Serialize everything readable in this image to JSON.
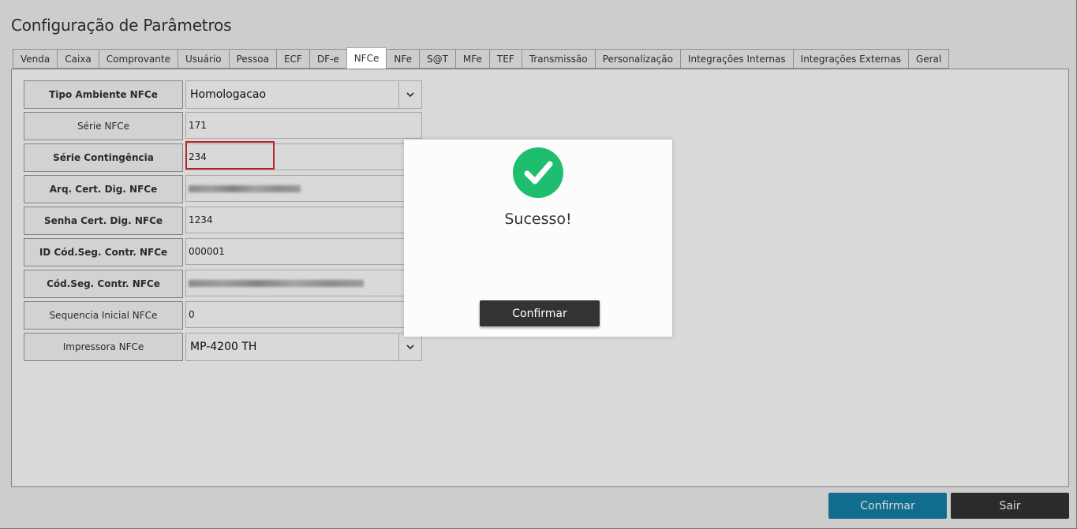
{
  "page": {
    "title": "Configuração de Parâmetros"
  },
  "tabs": [
    {
      "label": "Venda"
    },
    {
      "label": "Caixa"
    },
    {
      "label": "Comprovante"
    },
    {
      "label": "Usuário"
    },
    {
      "label": "Pessoa"
    },
    {
      "label": "ECF"
    },
    {
      "label": "DF-e"
    },
    {
      "label": "NFCe",
      "active": true
    },
    {
      "label": "NFe"
    },
    {
      "label": "S@T"
    },
    {
      "label": "MFe"
    },
    {
      "label": "TEF"
    },
    {
      "label": "Transmissão"
    },
    {
      "label": "Personalização"
    },
    {
      "label": "Integrações Internas"
    },
    {
      "label": "Integrações Externas"
    },
    {
      "label": "Geral"
    }
  ],
  "fields": [
    {
      "label": "Tipo Ambiente NFCe",
      "value": "Homologacao",
      "type": "select"
    },
    {
      "label": "Série NFCe",
      "value": "171"
    },
    {
      "label": "Série Contingência",
      "value": "234"
    },
    {
      "label": "Arq. Cert. Dig. NFCe",
      "value": "",
      "blurred": true
    },
    {
      "label": "Senha Cert. Dig. NFCe",
      "value": "1234"
    },
    {
      "label": "ID Cód.Seg. Contr. NFCe",
      "value": "000001"
    },
    {
      "label": "Cód.Seg. Contr. NFCe",
      "value": "",
      "blurred": true
    },
    {
      "label": "Sequencia Inicial NFCe",
      "value": "0"
    },
    {
      "label": "Impressora NFCe",
      "value": "MP-4200 TH",
      "type": "select"
    }
  ],
  "modal": {
    "title": "Sucesso!",
    "confirm_label": "Confirmar",
    "icon": "check-circle-icon",
    "icon_color": "#1fbe6e"
  },
  "footer": {
    "confirm_label": "Confirmar",
    "exit_label": "Sair",
    "confirm_color": "#1580a6",
    "exit_color": "#333333"
  }
}
